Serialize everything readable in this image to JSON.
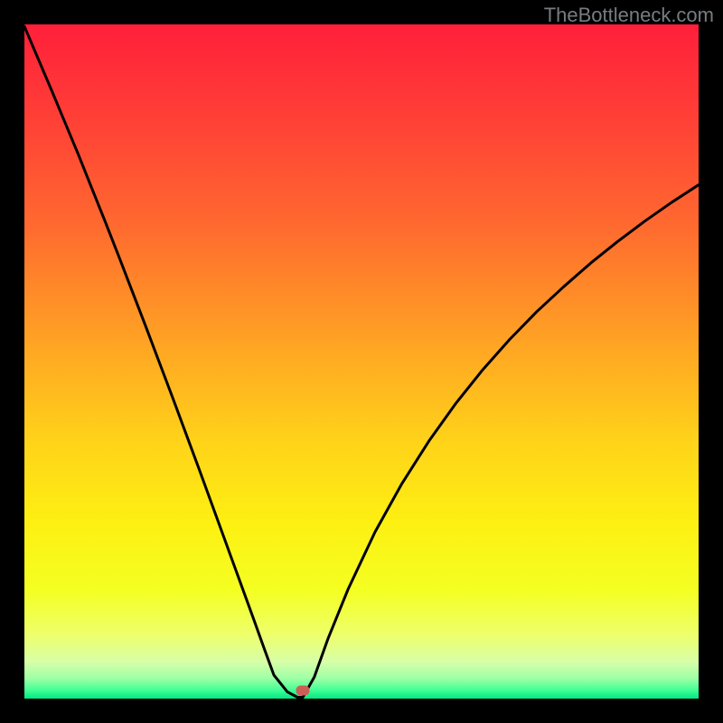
{
  "watermark": "TheBottleneck.com",
  "chart_data": {
    "type": "line",
    "title": "",
    "xlabel": "",
    "ylabel": "",
    "xlim": [
      0,
      100
    ],
    "ylim": [
      0,
      100
    ],
    "grid": false,
    "series": [
      {
        "name": "bottleneck-curve",
        "x": [
          0,
          2,
          4,
          6,
          8,
          10,
          12,
          14,
          16,
          18,
          20,
          22,
          24,
          26,
          28,
          30,
          32,
          34,
          35.5,
          37,
          39,
          40.5,
          41.3,
          43,
          45,
          48,
          52,
          56,
          60,
          64,
          68,
          72,
          76,
          80,
          84,
          88,
          92,
          96,
          100
        ],
        "y": [
          99.7,
          95.0,
          90.3,
          85.5,
          80.7,
          75.7,
          70.7,
          65.6,
          60.4,
          55.2,
          49.9,
          44.6,
          39.2,
          33.8,
          28.3,
          22.8,
          17.3,
          11.8,
          7.6,
          3.5,
          1.0,
          0.2,
          0.2,
          3.2,
          8.8,
          16.2,
          24.7,
          31.9,
          38.2,
          43.8,
          48.8,
          53.3,
          57.4,
          61.1,
          64.6,
          67.8,
          70.8,
          73.6,
          76.2
        ]
      }
    ],
    "marker": {
      "x": 41.3,
      "y": 1.2,
      "color": "#cb5f58"
    },
    "gradient_stops": [
      {
        "offset": 0.0,
        "color": "#ff1f3a"
      },
      {
        "offset": 0.15,
        "color": "#ff4236"
      },
      {
        "offset": 0.3,
        "color": "#ff6a2f"
      },
      {
        "offset": 0.48,
        "color": "#ffa623"
      },
      {
        "offset": 0.62,
        "color": "#ffd319"
      },
      {
        "offset": 0.74,
        "color": "#fdf012"
      },
      {
        "offset": 0.84,
        "color": "#f4ff22"
      },
      {
        "offset": 0.905,
        "color": "#eeff6b"
      },
      {
        "offset": 0.945,
        "color": "#d8ffa8"
      },
      {
        "offset": 0.97,
        "color": "#9effa6"
      },
      {
        "offset": 0.988,
        "color": "#3eff95"
      },
      {
        "offset": 1.0,
        "color": "#00e884"
      }
    ]
  }
}
